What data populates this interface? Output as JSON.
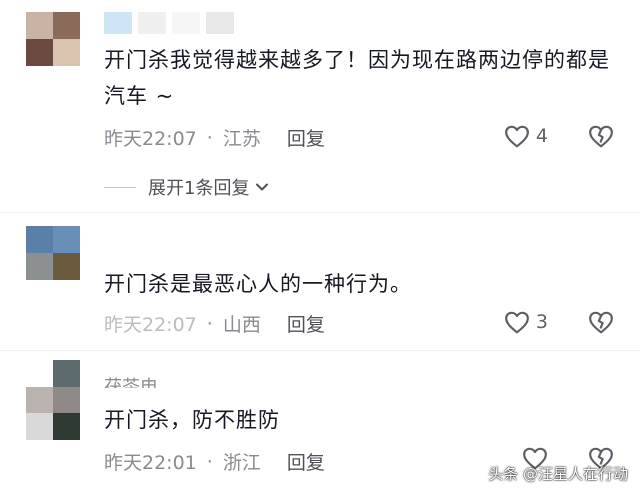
{
  "comments": [
    {
      "text": "开门杀我觉得越来越多了！因为现在路两边停的都是汽车 ~",
      "time": "昨天22:07",
      "dot": "·",
      "location": "江苏",
      "reply_label": "回复",
      "like_count": "4",
      "expand_label": "展开1条回复"
    },
    {
      "text": "开门杀是最恶心人的一种行为。",
      "time": "昨天22:07",
      "dot": "·",
      "location": "山西",
      "reply_label": "回复",
      "like_count": "3"
    },
    {
      "partial_name": "茯苓电",
      "text": "开门杀，防不胜防",
      "time": "昨天22:01",
      "dot": "·",
      "location": "浙江",
      "reply_label": "回复"
    }
  ],
  "watermark": "头条 @汪星人在行动",
  "icons": {
    "like": "heart-outline-icon",
    "dislike": "broken-heart-icon",
    "expand": "chevron-down-icon"
  },
  "colors": {
    "text": "#161823",
    "meta": "#8a8b91",
    "icon": "#5d5e66"
  }
}
